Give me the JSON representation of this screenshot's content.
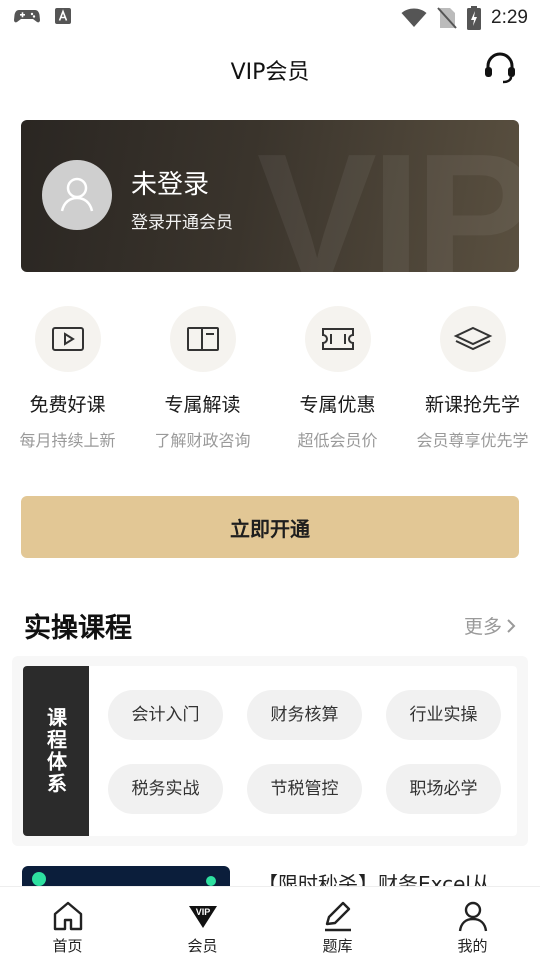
{
  "status_bar": {
    "time": "2:29"
  },
  "header": {
    "title": "VIP会员"
  },
  "banner": {
    "watermark": "VIP",
    "login_title": "未登录",
    "login_subtitle": "登录开通会员"
  },
  "benefits": [
    {
      "title": "免费好课",
      "subtitle": "每月持续上新",
      "icon": "play-video-icon"
    },
    {
      "title": "专属解读",
      "subtitle": "了解财政咨询",
      "icon": "book-icon"
    },
    {
      "title": "专属优惠",
      "subtitle": "超低会员价",
      "icon": "ticket-icon"
    },
    {
      "title": "新课抢先学",
      "subtitle": "会员尊享优先学",
      "icon": "layers-icon"
    }
  ],
  "open_button": {
    "label": "立即开通"
  },
  "practice_section": {
    "title": "实操课程",
    "more_label": "更多",
    "category_label": "课程体系",
    "chips": [
      "会计入门",
      "财务核算",
      "行业实操",
      "税务实战",
      "节税管控",
      "职场必学"
    ]
  },
  "promo": {
    "title": "【限时秒杀】财务Excel从"
  },
  "tabbar": [
    {
      "label": "首页",
      "icon": "home-icon"
    },
    {
      "label": "会员",
      "icon": "vip-diamond-icon",
      "badge": "VIP"
    },
    {
      "label": "题库",
      "icon": "pencil-icon"
    },
    {
      "label": "我的",
      "icon": "person-icon"
    }
  ],
  "colors": {
    "accent_gold": "#e2c795",
    "banner_dark": "#2a2622",
    "chip_bg": "#f1f1f1"
  }
}
